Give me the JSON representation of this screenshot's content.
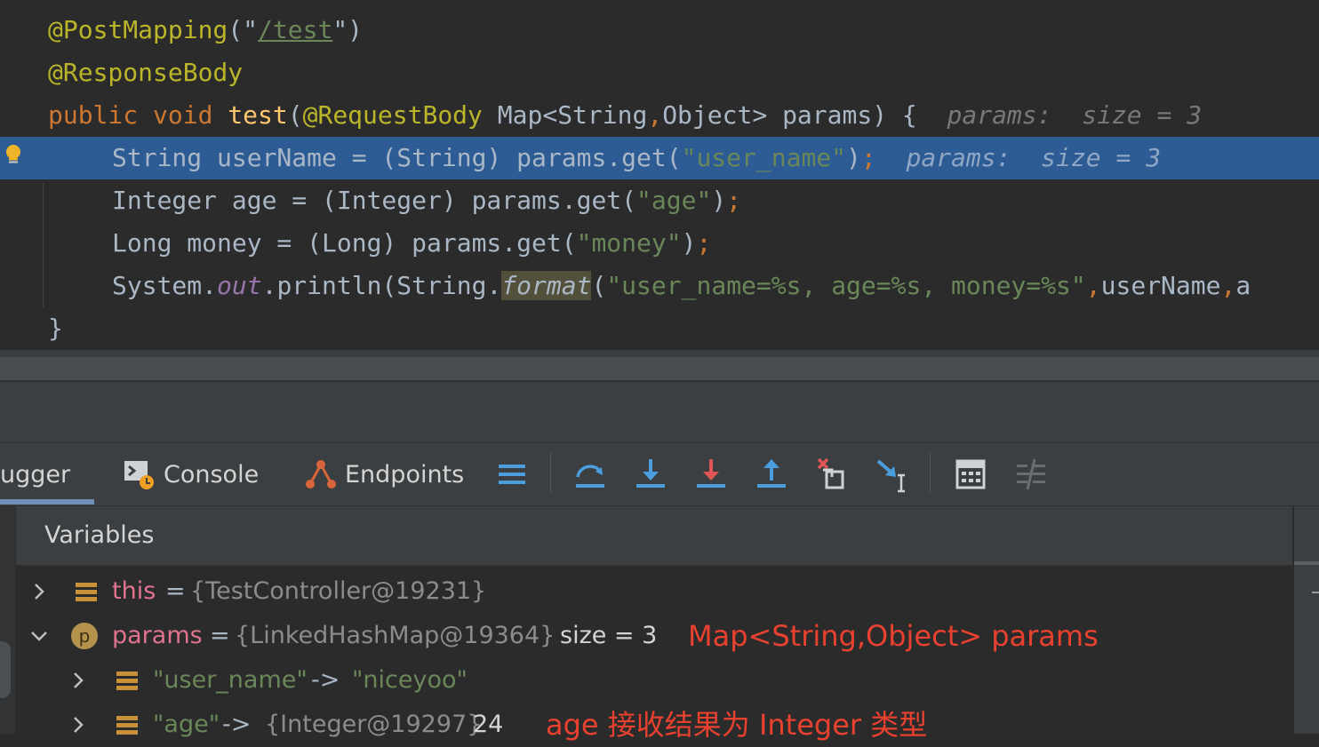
{
  "editor": {
    "line1": {
      "ann": "@PostMapping",
      "p1": "(\"",
      "url": "/test",
      "p2": "\")"
    },
    "line2": {
      "ann": "@ResponseBody"
    },
    "line3": {
      "kw1": "public",
      "kw2": "void",
      "fn": "test",
      "p1": "(",
      "ann": "@RequestBody",
      "sig": " Map<String",
      "comma": ",",
      "sig2": "Object> params) {",
      "hint": "params:  size = 3"
    },
    "line4": {
      "t1": "String userName = (String) params.get(",
      "s": "\"user_name\"",
      "t2": ")",
      "semi": ";",
      "hint": "params:  size = 3"
    },
    "line5": {
      "t1": "Integer age = (Integer) params.get(",
      "s": "\"age\"",
      "t2": ")",
      "semi": ";"
    },
    "line6": {
      "t1": "Long money = (Long) params.get(",
      "s": "\"money\"",
      "t2": ")",
      "semi": ";"
    },
    "line7": {
      "t1": "System.",
      "stat": "out",
      "t2": ".println(String.",
      "fmt": "format",
      "t3": "(",
      "s": "\"user_name=%s, age=%s, money=%s\"",
      "c1": ",",
      "t4": "userName",
      "c2": ",",
      "t5": "a"
    },
    "line8": {
      "t1": "}"
    }
  },
  "toolbar": {
    "tab_debugger": "ugger",
    "tab_console": "Console",
    "tab_endpoints": "Endpoints",
    "icons": [
      "frames-icon",
      "step-over-icon",
      "step-into-icon",
      "force-step-into-icon",
      "step-out-icon",
      "drop-frame-icon",
      "run-to-cursor-icon",
      "evaluate-expression-icon",
      "trace-icon"
    ]
  },
  "variables": {
    "title": "Variables",
    "rows": [
      {
        "name": "this",
        "eq": "=",
        "value": "{TestController@19231}"
      },
      {
        "name": "params",
        "eq": "=",
        "value": "{LinkedHashMap@19364}",
        "size": "size = 3",
        "note": "Map<String,Object> params"
      },
      {
        "key": "\"user_name\"",
        "arrow": "->",
        "value": "\"niceyoo\""
      },
      {
        "key": "\"age\"",
        "arrow": "->",
        "value": "{Integer@19297}",
        "num": "24",
        "note": "age 接收结果为 Integer 类型"
      }
    ]
  },
  "colors": {
    "editor_bg": "#2b2b2b",
    "current_line": "#2d5b94",
    "annotation": "#bbb529",
    "keyword": "#cc7832",
    "function": "#ffc66d",
    "string": "#6a8759",
    "note_red": "#e9412f"
  }
}
